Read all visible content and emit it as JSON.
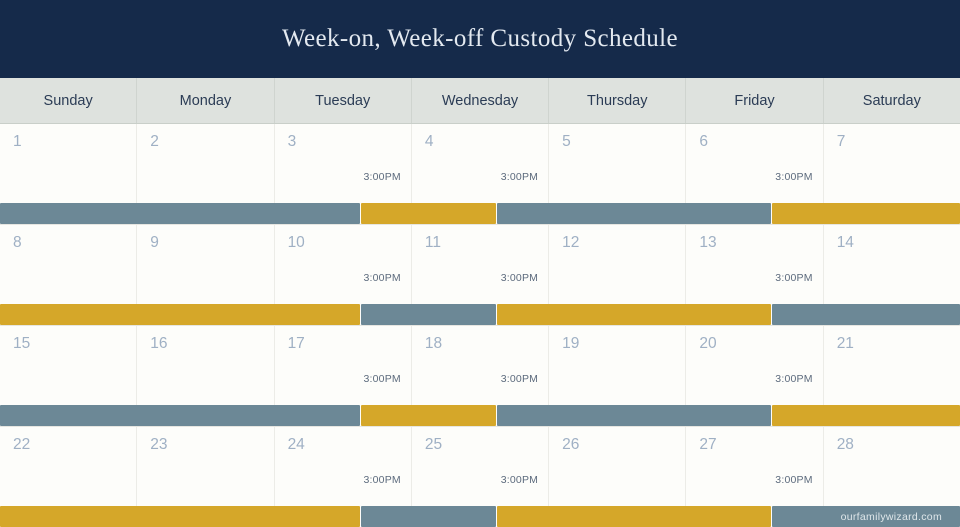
{
  "header": {
    "title": "Week-on, Week-off Custody Schedule",
    "background_color": "#152a4a",
    "text_color": "#e3e9f0"
  },
  "weekdays": [
    {
      "label": "Sunday"
    },
    {
      "label": "Monday"
    },
    {
      "label": "Tuesday"
    },
    {
      "label": "Wednesday"
    },
    {
      "label": "Thursday"
    },
    {
      "label": "Friday"
    },
    {
      "label": "Saturday"
    }
  ],
  "legend_colors": {
    "parent_a": "#6c8896",
    "parent_b": "#d5a729",
    "cell_background": "#fdfdfa",
    "weekday_header_background": "#dee2de",
    "day_number": "#9fb0c4",
    "time_label": "#5d6b7d"
  },
  "exchange_time": "3:00PM",
  "weeks": [
    {
      "days": [
        {
          "number": "1",
          "time": ""
        },
        {
          "number": "2",
          "time": ""
        },
        {
          "number": "3",
          "time": "3:00PM"
        },
        {
          "number": "4",
          "time": "3:00PM"
        },
        {
          "number": "5",
          "time": ""
        },
        {
          "number": "6",
          "time": "3:00PM"
        },
        {
          "number": "7",
          "time": ""
        }
      ],
      "bars": [
        {
          "parent": "parent_a",
          "left_pct": 0.0,
          "width_pct": 37.5
        },
        {
          "parent": "parent_b",
          "left_pct": 37.6,
          "width_pct": 14.06
        },
        {
          "parent": "parent_a",
          "left_pct": 51.77,
          "width_pct": 28.54
        },
        {
          "parent": "parent_b",
          "left_pct": 80.42,
          "width_pct": 19.58
        }
      ]
    },
    {
      "days": [
        {
          "number": "8",
          "time": ""
        },
        {
          "number": "9",
          "time": ""
        },
        {
          "number": "10",
          "time": "3:00PM"
        },
        {
          "number": "11",
          "time": "3:00PM"
        },
        {
          "number": "12",
          "time": ""
        },
        {
          "number": "13",
          "time": "3:00PM"
        },
        {
          "number": "14",
          "time": ""
        }
      ],
      "bars": [
        {
          "parent": "parent_b",
          "left_pct": 0.0,
          "width_pct": 37.5
        },
        {
          "parent": "parent_a",
          "left_pct": 37.6,
          "width_pct": 14.06
        },
        {
          "parent": "parent_b",
          "left_pct": 51.77,
          "width_pct": 28.54
        },
        {
          "parent": "parent_a",
          "left_pct": 80.42,
          "width_pct": 19.58
        }
      ]
    },
    {
      "days": [
        {
          "number": "15",
          "time": ""
        },
        {
          "number": "16",
          "time": ""
        },
        {
          "number": "17",
          "time": "3:00PM"
        },
        {
          "number": "18",
          "time": "3:00PM"
        },
        {
          "number": "19",
          "time": ""
        },
        {
          "number": "20",
          "time": "3:00PM"
        },
        {
          "number": "21",
          "time": ""
        }
      ],
      "bars": [
        {
          "parent": "parent_a",
          "left_pct": 0.0,
          "width_pct": 37.5
        },
        {
          "parent": "parent_b",
          "left_pct": 37.6,
          "width_pct": 14.06
        },
        {
          "parent": "parent_a",
          "left_pct": 51.77,
          "width_pct": 28.54
        },
        {
          "parent": "parent_b",
          "left_pct": 80.42,
          "width_pct": 19.58
        }
      ]
    },
    {
      "days": [
        {
          "number": "22",
          "time": ""
        },
        {
          "number": "23",
          "time": ""
        },
        {
          "number": "24",
          "time": "3:00PM"
        },
        {
          "number": "25",
          "time": "3:00PM"
        },
        {
          "number": "26",
          "time": ""
        },
        {
          "number": "27",
          "time": "3:00PM"
        },
        {
          "number": "28",
          "time": ""
        }
      ],
      "bars": [
        {
          "parent": "parent_b",
          "left_pct": 0.0,
          "width_pct": 37.5
        },
        {
          "parent": "parent_a",
          "left_pct": 37.6,
          "width_pct": 14.06
        },
        {
          "parent": "parent_b",
          "left_pct": 51.77,
          "width_pct": 28.54
        },
        {
          "parent": "parent_a",
          "left_pct": 80.42,
          "width_pct": 19.58
        }
      ]
    }
  ],
  "watermark": {
    "text": "ourfamilywizard.com"
  }
}
